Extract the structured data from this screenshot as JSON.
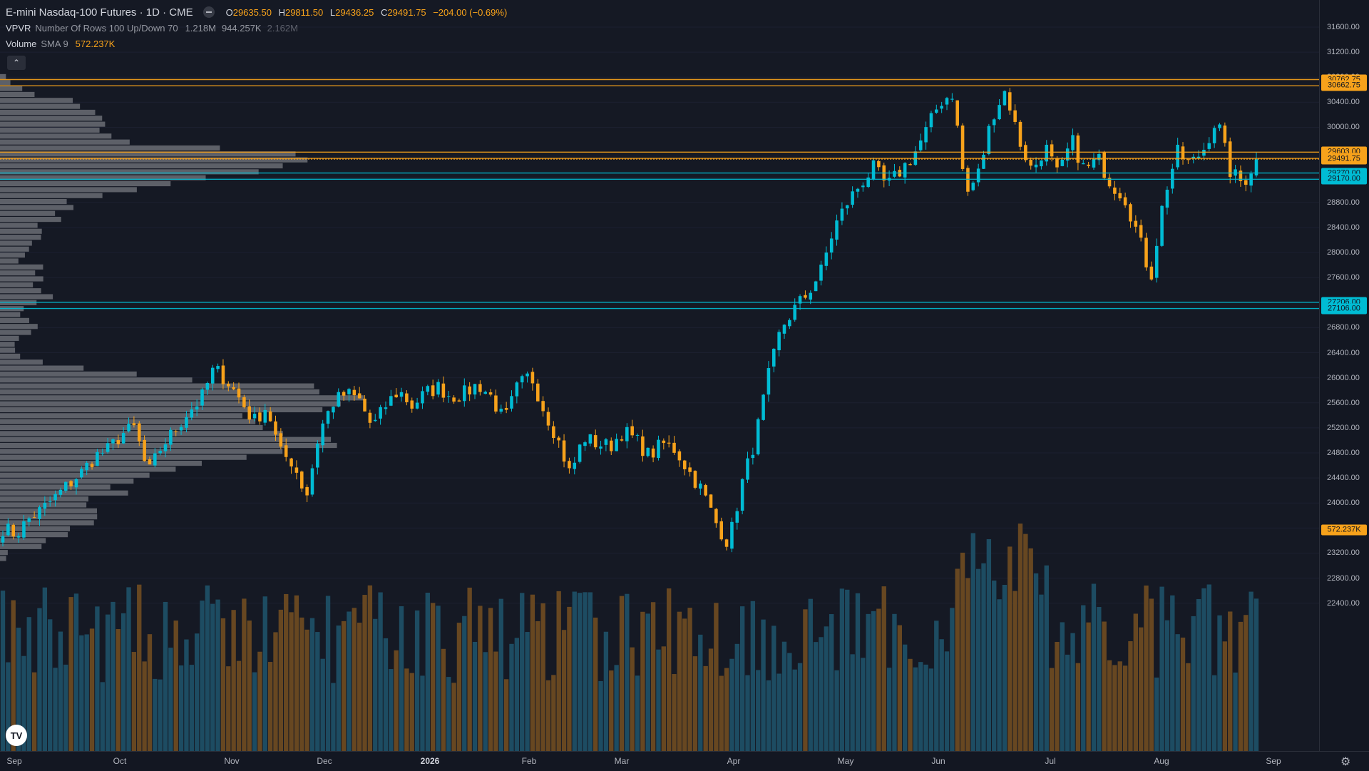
{
  "symbol": {
    "title": "E-mini Nasdaq-100 Futures · 1D · CME",
    "ohlc": {
      "o_key": "O",
      "o_val": "29635.50",
      "h_key": "H",
      "h_val": "29811.50",
      "l_key": "L",
      "l_val": "29436.25",
      "c_key": "C",
      "c_val": "29491.75",
      "change": "−204.00 (−0.69%)"
    }
  },
  "indicators": {
    "vpvr": {
      "name": "VPVR",
      "params": "Number Of Rows 100 Up/Down 70",
      "v1": "1.218M",
      "v2": "944.257K",
      "v3": "2.162M"
    },
    "volume": {
      "name": "Volume",
      "params": "SMA 9",
      "value": "572.237K"
    }
  },
  "controls": {
    "collapse": "⌃",
    "logo": "TV",
    "settings": "⚙"
  },
  "colors": {
    "background": "#151924",
    "up": "#00bcd4",
    "down": "#f7a21b",
    "vol_up": "#1d4f66",
    "vol_down": "#6b4a22",
    "profile_bar": "#7c7f86",
    "orange_line": "#f7a21b",
    "cyan_line": "#00bcd4"
  },
  "price_axis": {
    "ticks": [
      "31600.00",
      "31200.00",
      "30800.00",
      "30400.00",
      "30000.00",
      "29600.00",
      "29200.00",
      "28800.00",
      "28400.00",
      "28000.00",
      "27600.00",
      "27200.00",
      "26800.00",
      "26400.00",
      "26000.00",
      "25600.00",
      "25200.00",
      "24800.00",
      "24400.00",
      "24000.00",
      "23600.00",
      "23200.00",
      "22800.00",
      "22400.00"
    ],
    "labels": [
      {
        "text": "30762.75",
        "price": 30762.75,
        "color": "#f7a21b"
      },
      {
        "text": "30662.75",
        "price": 30662.75,
        "color": "#f7a21b"
      },
      {
        "text": "29603.00",
        "price": 29603,
        "color": "#f7a21b"
      },
      {
        "text": "29503.00",
        "price": 29503,
        "color": "#f7a21b"
      },
      {
        "text": "29491.75",
        "price": 29491.75,
        "color": "#f7a21b"
      },
      {
        "text": "29270.00",
        "price": 29270,
        "color": "#00bcd4"
      },
      {
        "text": "29170.00",
        "price": 29170,
        "color": "#00bcd4"
      },
      {
        "text": "27206.00",
        "price": 27206,
        "color": "#00bcd4"
      },
      {
        "text": "27106.00",
        "price": 27106,
        "color": "#00bcd4"
      },
      {
        "text": "572.237K",
        "price": 23570,
        "color": "#f7a21b"
      }
    ]
  },
  "time_axis": {
    "labels": [
      {
        "text": "Sep",
        "bold": false
      },
      {
        "text": "Oct",
        "bold": false
      },
      {
        "text": "Nov",
        "bold": false
      },
      {
        "text": "Dec",
        "bold": false
      },
      {
        "text": "2026",
        "bold": true
      },
      {
        "text": "Feb",
        "bold": false
      },
      {
        "text": "Mar",
        "bold": false
      },
      {
        "text": "Apr",
        "bold": false
      },
      {
        "text": "May",
        "bold": false
      },
      {
        "text": "Jun",
        "bold": false
      },
      {
        "text": "Jul",
        "bold": false
      },
      {
        "text": "Aug",
        "bold": false
      },
      {
        "text": "Sep",
        "bold": false
      }
    ]
  },
  "chart_data": {
    "type": "candlestick",
    "title": "E-mini Nasdaq-100 Futures · 1D · CME",
    "y_range": [
      22300,
      31800
    ],
    "horizontal_levels": [
      30762.75,
      30662.75,
      29603,
      29503,
      29491.75,
      29270,
      29170,
      27206,
      27106
    ],
    "volume_sma": "572.237K",
    "anchors": [
      {
        "t": "Sep",
        "p": 23600
      },
      {
        "t": "Sep",
        "p": 23500
      },
      {
        "t": "Sep",
        "p": 23750
      },
      {
        "t": "Sep",
        "p": 23900
      },
      {
        "t": "Sep",
        "p": 24100
      },
      {
        "t": "Sep",
        "p": 24300
      },
      {
        "t": "Sep",
        "p": 24500
      },
      {
        "t": "Sep",
        "p": 24750
      },
      {
        "t": "Oct",
        "p": 24850
      },
      {
        "t": "Oct",
        "p": 25100
      },
      {
        "t": "Oct",
        "p": 25200
      },
      {
        "t": "Oct",
        "p": 24450
      },
      {
        "t": "Oct",
        "p": 24900
      },
      {
        "t": "Oct",
        "p": 25150
      },
      {
        "t": "Oct",
        "p": 25450
      },
      {
        "t": "Oct",
        "p": 25650
      },
      {
        "t": "Nov",
        "p": 26150
      },
      {
        "t": "Nov",
        "p": 25950
      },
      {
        "t": "Nov",
        "p": 25650
      },
      {
        "t": "Nov",
        "p": 25300
      },
      {
        "t": "Nov",
        "p": 25550
      },
      {
        "t": "Nov",
        "p": 24800
      },
      {
        "t": "Nov",
        "p": 24650
      },
      {
        "t": "Nov",
        "p": 24100
      },
      {
        "t": "Dec",
        "p": 25150
      },
      {
        "t": "Dec",
        "p": 25600
      },
      {
        "t": "Dec",
        "p": 25750
      },
      {
        "t": "Dec",
        "p": 25650
      },
      {
        "t": "Dec",
        "p": 25200
      },
      {
        "t": "Dec",
        "p": 25550
      },
      {
        "t": "Dec",
        "p": 25800
      },
      {
        "t": "Dec",
        "p": 25550
      },
      {
        "t": "Jan",
        "p": 25750
      },
      {
        "t": "Jan",
        "p": 25850
      },
      {
        "t": "Jan",
        "p": 25700
      },
      {
        "t": "Jan",
        "p": 25750
      },
      {
        "t": "Jan",
        "p": 25900
      },
      {
        "t": "Jan",
        "p": 25700
      },
      {
        "t": "Jan",
        "p": 25300
      },
      {
        "t": "Jan",
        "p": 25850
      },
      {
        "t": "Feb",
        "p": 26050
      },
      {
        "t": "Feb",
        "p": 25500
      },
      {
        "t": "Feb",
        "p": 25050
      },
      {
        "t": "Feb",
        "p": 24450
      },
      {
        "t": "Feb",
        "p": 25050
      },
      {
        "t": "Feb",
        "p": 24950
      },
      {
        "t": "Feb",
        "p": 24900
      },
      {
        "t": "Feb",
        "p": 25150
      },
      {
        "t": "Mar",
        "p": 25000
      },
      {
        "t": "Mar",
        "p": 24750
      },
      {
        "t": "Mar",
        "p": 24950
      },
      {
        "t": "Mar",
        "p": 24850
      },
      {
        "t": "Mar",
        "p": 24500
      },
      {
        "t": "Mar",
        "p": 24200
      },
      {
        "t": "Mar",
        "p": 23700
      },
      {
        "t": "Mar",
        "p": 23350
      },
      {
        "t": "Apr",
        "p": 24300
      },
      {
        "t": "Apr",
        "p": 25000
      },
      {
        "t": "Apr",
        "p": 26000
      },
      {
        "t": "Apr",
        "p": 26800
      },
      {
        "t": "Apr",
        "p": 27100
      },
      {
        "t": "Apr",
        "p": 27350
      },
      {
        "t": "Apr",
        "p": 27700
      },
      {
        "t": "Apr",
        "p": 28400
      },
      {
        "t": "May",
        "p": 28800
      },
      {
        "t": "May",
        "p": 29100
      },
      {
        "t": "May",
        "p": 29350
      },
      {
        "t": "May",
        "p": 29050
      },
      {
        "t": "May",
        "p": 29300
      },
      {
        "t": "May",
        "p": 29550
      },
      {
        "t": "May",
        "p": 29950
      },
      {
        "t": "May",
        "p": 30400
      },
      {
        "t": "Jun",
        "p": 30550
      },
      {
        "t": "Jun",
        "p": 28900
      },
      {
        "t": "Jun",
        "p": 29300
      },
      {
        "t": "Jun",
        "p": 30200
      },
      {
        "t": "Jun",
        "p": 30600
      },
      {
        "t": "Jun",
        "p": 29800
      },
      {
        "t": "Jun",
        "p": 29300
      },
      {
        "t": "Jun",
        "p": 29700
      },
      {
        "t": "Jul",
        "p": 29200
      },
      {
        "t": "Jul",
        "p": 29800
      },
      {
        "t": "Jul",
        "p": 29300
      },
      {
        "t": "Jul",
        "p": 29500
      },
      {
        "t": "Jul",
        "p": 29100
      },
      {
        "t": "Jul",
        "p": 28900
      },
      {
        "t": "Jul",
        "p": 28300
      },
      {
        "t": "Jul",
        "p": 27600
      },
      {
        "t": "Aug",
        "p": 28900
      },
      {
        "t": "Aug",
        "p": 29600
      },
      {
        "t": "Aug",
        "p": 29400
      },
      {
        "t": "Aug",
        "p": 29650
      },
      {
        "t": "Aug",
        "p": 30150
      },
      {
        "t": "Aug",
        "p": 29300
      },
      {
        "t": "Aug",
        "p": 29100
      },
      {
        "t": "Aug",
        "p": 29491.75
      }
    ]
  }
}
